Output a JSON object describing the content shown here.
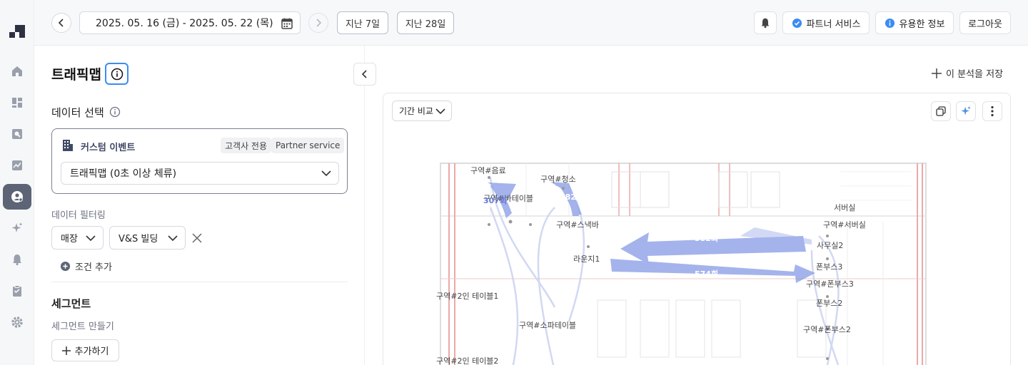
{
  "topbar": {
    "date_range": "2025. 05. 16 (금) - 2025. 05. 22 (목)",
    "last7": "지난 7일",
    "last28": "지난 28일",
    "partner_service": "파트너 서비스",
    "useful_info": "유용한 정보",
    "logout": "로그아웃"
  },
  "panel": {
    "title": "트래픽맵",
    "data_select_label": "데이터 선택",
    "custom_event": {
      "title": "커스텀 이벤트",
      "badge_client": "고객사 전용",
      "badge_partner": "Partner service",
      "selected": "트래픽맵 (0초 이상 체류)"
    },
    "filter_label": "데이터 필터링",
    "filter_chips": [
      "매장",
      "V&S 빌딩"
    ],
    "add_condition": "조건 추가",
    "segment_label": "세그먼트",
    "segment_make": "세그먼트 만들기",
    "add_button": "추가하기"
  },
  "main": {
    "save_analysis": "이 분석을 저장",
    "compare_button": "기간 비교"
  },
  "map": {
    "labels": [
      "구역#음료",
      "구역#청소",
      "구역#바테이블",
      "307회",
      "382회",
      "서버실",
      "구역#스낵바",
      "구역#서버실",
      "582회",
      "사무실2",
      "라운지1",
      "폰부스3",
      "574회",
      "구역#폰부스3",
      "구역#2인 테이블1",
      "폰부스2",
      "구역#소파테이블",
      "구역#폰부스2",
      "구역#2인 테이블2"
    ]
  },
  "colors": {
    "accent": "#3b8cf2",
    "rail_active": "#5d6476",
    "flow_arrow": "#8b9ee6",
    "floor_line": "#e9a5a5"
  },
  "icons": {
    "rail": [
      "home-icon",
      "dashboard-icon",
      "search-report-icon",
      "trend-icon",
      "user-journey-icon",
      "sparkle-icon",
      "bell-icon",
      "clipboard-icon",
      "gear-icon"
    ]
  }
}
